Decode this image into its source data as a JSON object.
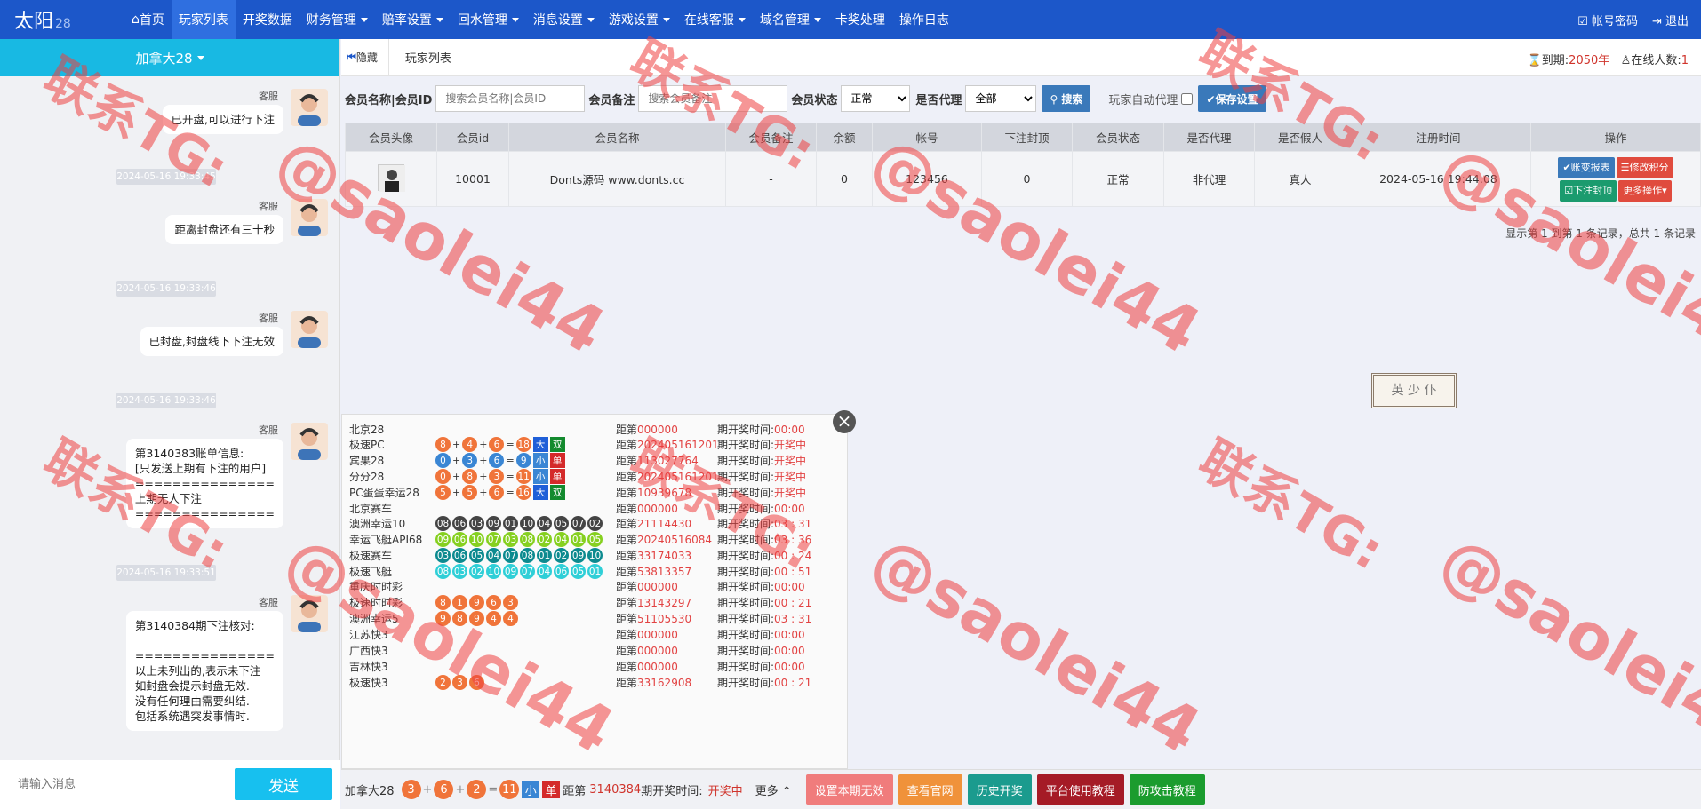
{
  "app": {
    "logo": "太阳",
    "logo_sup": "28"
  },
  "nav": {
    "items": [
      {
        "label": "首页",
        "icon": "home-icon"
      },
      {
        "label": "玩家列表",
        "active": true
      },
      {
        "label": "开奖数据"
      },
      {
        "label": "财务管理",
        "dropdown": true
      },
      {
        "label": "赔率设置",
        "dropdown": true
      },
      {
        "label": "回水管理",
        "dropdown": true
      },
      {
        "label": "消息设置",
        "dropdown": true
      },
      {
        "label": "游戏设置",
        "dropdown": true
      },
      {
        "label": "在线客服",
        "dropdown": true
      },
      {
        "label": "域名管理",
        "dropdown": true
      },
      {
        "label": "卡奖处理"
      },
      {
        "label": "操作日志"
      }
    ],
    "account_pwd": "帐号密码",
    "logout": "退出"
  },
  "left": {
    "game_select": "加拿大28",
    "messages": [
      {
        "sender": "客服",
        "text": "已开盘,可以进行下注"
      },
      {
        "sender": "客服",
        "text": "距离封盘还有三十秒"
      },
      {
        "sender": "客服",
        "text": "已封盘,封盘线下下注无效"
      },
      {
        "sender": "客服",
        "text": "第3140383账单信息:\n[只发送上期有下注的用户]\n===============\n上期无人下注\n==============="
      },
      {
        "sender": "客服",
        "text": "第3140384期下注核对:\n\n===============\n以上未列出的,表示未下注\n如封盘会提示封盘无效.\n没有任何理由需要纠结.\n包括系统遇突发事情时."
      }
    ],
    "timestamps": [
      "2024-05-16 19:33:45",
      "2024-05-16 19:33:46",
      "2024-05-16 19:33:46",
      "2024-05-16 19:33:51"
    ],
    "input_placeholder": "请输入消息",
    "send_label": "发送"
  },
  "tabbar": {
    "hide_label": "隐藏",
    "tab_label": "玩家列表",
    "expire_label": "到期:",
    "expire_value": "2050年",
    "online_label": "在线人数:",
    "online_value": "1"
  },
  "filter": {
    "name_label": "会员名称|会员ID",
    "name_placeholder": "搜索会员名称|会员ID",
    "remark_label": "会员备注",
    "remark_placeholder": "搜索会员备注",
    "status_label": "会员状态",
    "status_value": "正常",
    "agent_label": "是否代理",
    "agent_value": "全部",
    "search_label": "搜索",
    "auto_agent_label": "玩家自动代理",
    "save_label": "保存设置"
  },
  "table": {
    "headers": [
      "会员头像",
      "会员id",
      "会员名称",
      "会员备注",
      "余额",
      "帐号",
      "下注封顶",
      "会员状态",
      "是否代理",
      "是否假人",
      "注册时间",
      "操作"
    ],
    "rows": [
      {
        "id": "10001",
        "name": "Donts源码 www.donts.cc",
        "remark": "-",
        "balance": "0",
        "account": "123456",
        "cap": "0",
        "status": "正常",
        "agent": "非代理",
        "fake": "真人",
        "reg_time": "2024-05-16 19:44:08"
      }
    ],
    "actions": [
      "账变报表",
      "修改积分",
      "下注封顶",
      "更多操作"
    ],
    "pager": "显示第 1 到第 1 条记录，总共 1 条记录"
  },
  "stamp": "英 少 仆",
  "lottery": {
    "period_prefix": "距第",
    "time_label": "期开奖时间:",
    "games": [
      {
        "name": "北京28",
        "period": "000000",
        "time": "00:00",
        "time_red": true
      },
      {
        "name": "极速PC",
        "nums": [
          "8",
          "4",
          "6"
        ],
        "sum": "18",
        "size": "大",
        "parity": "双",
        "color": "o",
        "period": "202405161201",
        "time": "开奖中",
        "time_red": true
      },
      {
        "name": "宾果28",
        "nums": [
          "0",
          "3",
          "6"
        ],
        "sum": "9",
        "size": "小",
        "parity": "单",
        "color": "b",
        "period": "113027764",
        "time": "开奖中",
        "time_red": true
      },
      {
        "name": "分分28",
        "nums": [
          "0",
          "8",
          "3"
        ],
        "sum": "11",
        "size": "小",
        "parity": "单",
        "color": "o",
        "period": "202405161201",
        "time": "开奖中",
        "time_red": true
      },
      {
        "name": "PC蛋蛋幸运28",
        "nums": [
          "5",
          "5",
          "6"
        ],
        "sum": "16",
        "size": "大",
        "parity": "双",
        "color": "o",
        "period": "10939678",
        "time": "开奖中",
        "time_red": true
      },
      {
        "name": "北京赛车",
        "period": "000000",
        "time": "00:00",
        "time_red": true
      },
      {
        "name": "澳洲幸运10",
        "balls": [
          "08",
          "06",
          "03",
          "09",
          "01",
          "10",
          "04",
          "05",
          "07",
          "02"
        ],
        "color": "k",
        "period": "21114430",
        "time": "03 : 31"
      },
      {
        "name": "幸运飞艇API68",
        "balls": [
          "09",
          "06",
          "10",
          "07",
          "03",
          "08",
          "02",
          "04",
          "01",
          "05"
        ],
        "color": "l",
        "period": "20240516084",
        "time": "03 : 36"
      },
      {
        "name": "极速赛车",
        "balls": [
          "03",
          "06",
          "05",
          "04",
          "07",
          "08",
          "01",
          "02",
          "09",
          "10"
        ],
        "color": "t",
        "period": "33174033",
        "time": "00 : 24"
      },
      {
        "name": "极速飞艇",
        "balls": [
          "08",
          "03",
          "02",
          "10",
          "09",
          "07",
          "04",
          "06",
          "05",
          "01"
        ],
        "color": "c",
        "period": "53813357",
        "time": "00 : 51"
      },
      {
        "name": "重庆时时彩",
        "period": "000000",
        "time": "00:00",
        "time_red": true
      },
      {
        "name": "极速时时彩",
        "balls": [
          "8",
          "1",
          "9",
          "6",
          "3"
        ],
        "color": "o",
        "period": "13143297",
        "time": "00 : 21"
      },
      {
        "name": "澳洲幸运5",
        "balls": [
          "9",
          "8",
          "9",
          "4",
          "4"
        ],
        "color": "o",
        "period": "51105530",
        "time": "03 : 31"
      },
      {
        "name": "江苏快3",
        "period": "000000",
        "time": "00:00",
        "time_red": true
      },
      {
        "name": "广西快3",
        "period": "000000",
        "time": "00:00",
        "time_red": true
      },
      {
        "name": "吉林快3",
        "period": "000000",
        "time": "00:00",
        "time_red": true
      },
      {
        "name": "极速快3",
        "balls": [
          "2",
          "3",
          "6"
        ],
        "color": "o",
        "period": "33162908",
        "time": "00 : 21"
      }
    ]
  },
  "bottom": {
    "game": "加拿大28",
    "nums": [
      "3",
      "6",
      "2"
    ],
    "sum": "11",
    "size": "小",
    "parity": "单",
    "period_prefix": "距第",
    "period": "3140384",
    "time_label": "期开奖时间:",
    "time_value": "开奖中",
    "more_label": "更多",
    "buttons": [
      {
        "label": "设置本期无效",
        "color": "#f07c7c"
      },
      {
        "label": "查看官网",
        "color": "#f0923a"
      },
      {
        "label": "历史开奖",
        "color": "#1b9b8e"
      },
      {
        "label": "平台使用教程",
        "color": "#a51b26"
      },
      {
        "label": "防攻击教程",
        "color": "#1b9c2e"
      }
    ]
  },
  "watermark": {
    "line1": "联系TG:",
    "line2": "@saolei44"
  }
}
